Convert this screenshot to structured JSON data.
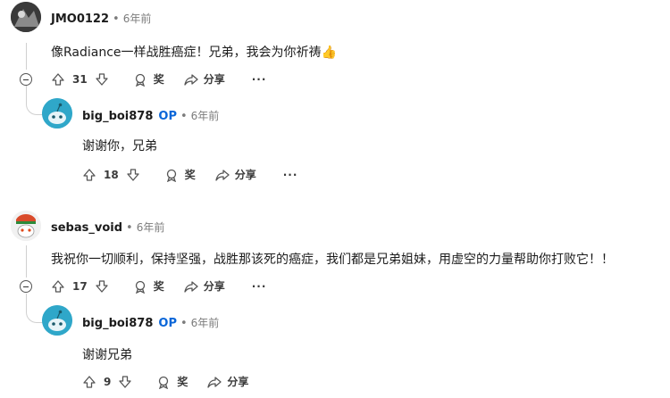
{
  "comments": [
    {
      "user": "JMO0122",
      "time": "6年前",
      "text": "像Radiance一样战胜癌症！兄弟，我会为你祈祷👍",
      "votes": "31",
      "award_label": "奖",
      "share_label": "分享",
      "more": "···"
    },
    {
      "user": "big_boi878",
      "op": "OP",
      "time": "6年前",
      "text": "谢谢你，兄弟",
      "votes": "18",
      "award_label": "奖",
      "share_label": "分享",
      "more": "···"
    },
    {
      "user": "sebas_void",
      "time": "6年前",
      "text": "我祝你一切顺利，保持坚强，战胜那该死的癌症，我们都是兄弟姐妹，用虚空的力量帮助你打败它！！",
      "votes": "17",
      "award_label": "奖",
      "share_label": "分享",
      "more": "···"
    },
    {
      "user": "big_boi878",
      "op": "OP",
      "time": "6年前",
      "text": "谢谢兄弟",
      "votes": "9",
      "award_label": "奖",
      "share_label": "分享"
    }
  ],
  "dot": "•",
  "colors": {
    "op": "#0a66d8",
    "snoo": "#2fa7c9",
    "line": "#d0d0d0"
  }
}
